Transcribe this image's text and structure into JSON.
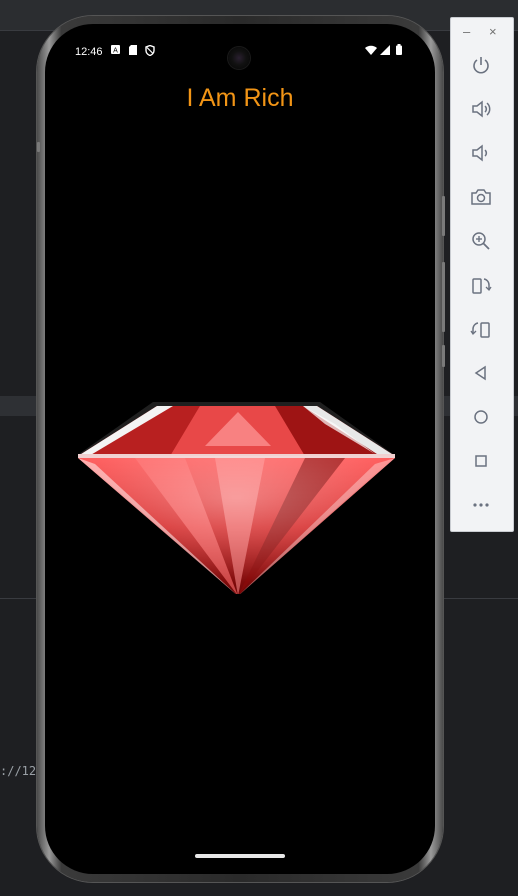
{
  "ide": {
    "code_fragment": "://12"
  },
  "status_bar": {
    "time": "12:46"
  },
  "app": {
    "title": "I Am Rich",
    "title_color": "#f29516",
    "image": "red-diamond"
  },
  "emulator_toolbar": {
    "window_controls": [
      "–",
      "×"
    ],
    "tools": [
      {
        "name": "power-icon"
      },
      {
        "name": "volume-up-icon"
      },
      {
        "name": "volume-down-icon"
      },
      {
        "name": "camera-icon"
      },
      {
        "name": "zoom-in-icon"
      },
      {
        "name": "rotate-left-icon"
      },
      {
        "name": "rotate-right-icon"
      },
      {
        "name": "back-icon"
      },
      {
        "name": "home-icon"
      },
      {
        "name": "overview-icon"
      },
      {
        "name": "more-icon"
      }
    ]
  }
}
